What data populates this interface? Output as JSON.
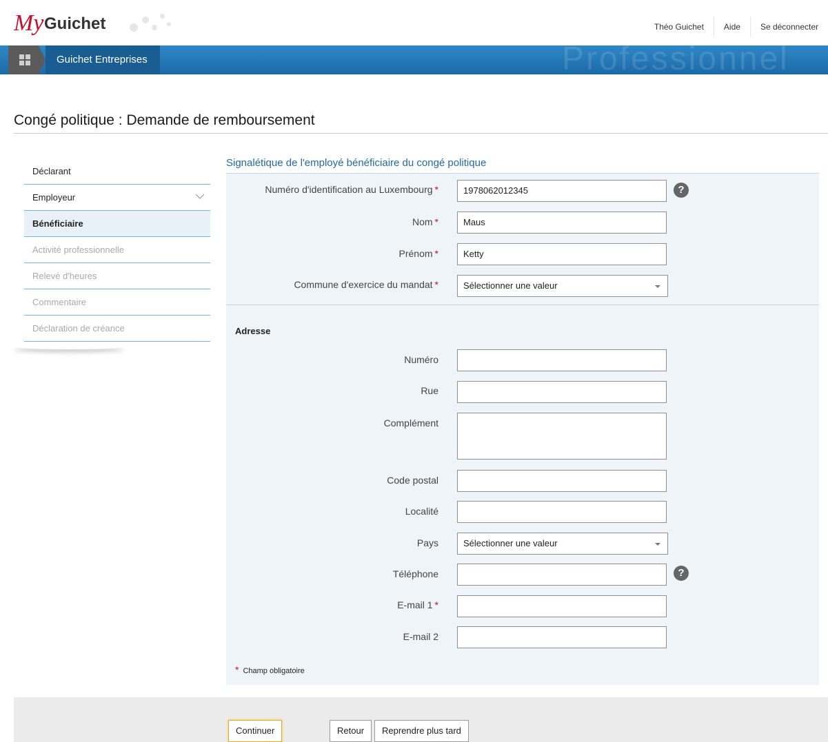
{
  "header": {
    "logo_my": "My",
    "logo_guichet": "Guichet",
    "user_name": "Théo Guichet",
    "help_link": "Aide",
    "logout_link": "Se déconnecter"
  },
  "nav_bar": {
    "breadcrumb": "Guichet Entreprises",
    "watermark": "Professionnel"
  },
  "page": {
    "title": "Congé politique : Demande de remboursement"
  },
  "sidebar": {
    "items": [
      {
        "label": "Déclarant",
        "state": "done"
      },
      {
        "label": "Employeur",
        "state": "done"
      },
      {
        "label": "Bénéficiaire",
        "state": "active"
      },
      {
        "label": "Activité professionnelle",
        "state": "disabled"
      },
      {
        "label": "Relevé d'heures",
        "state": "disabled"
      },
      {
        "label": "Commentaire",
        "state": "disabled"
      },
      {
        "label": "Déclaration de créance",
        "state": "disabled"
      }
    ]
  },
  "form": {
    "section_title": "Signalétique de l'employé bénéficiaire du congé politique",
    "required_marker": "*",
    "help_glyph": "?",
    "matricule": {
      "label": "Numéro d'identification au Luxembourg",
      "value": "1978062012345"
    },
    "nom": {
      "label": "Nom",
      "value": "Maus"
    },
    "prenom": {
      "label": "Prénom",
      "value": "Ketty"
    },
    "commune": {
      "label": "Commune d'exercice du mandat",
      "value": "Sélectionner une valeur"
    },
    "address_title": "Adresse",
    "numero": {
      "label": "Numéro",
      "value": ""
    },
    "rue": {
      "label": "Rue",
      "value": ""
    },
    "complement": {
      "label": "Complément",
      "value": ""
    },
    "code_postal": {
      "label": "Code postal",
      "value": ""
    },
    "localite": {
      "label": "Localité",
      "value": ""
    },
    "pays": {
      "label": "Pays",
      "value": "Sélectionner une valeur"
    },
    "telephone": {
      "label": "Téléphone",
      "value": ""
    },
    "email1": {
      "label": "E-mail 1",
      "value": ""
    },
    "email2": {
      "label": "E-mail 2",
      "value": ""
    },
    "required_note": "Champ obligatoire"
  },
  "footer": {
    "continue_label": "Continuer",
    "back_label": "Retour",
    "later_label": "Reprendre plus tard"
  },
  "colors": {
    "brand_red": "#c8102e",
    "bar_blue": "#1c6aa8",
    "section_blue": "#1f6aa5",
    "panel_bg": "#eef4f8"
  }
}
